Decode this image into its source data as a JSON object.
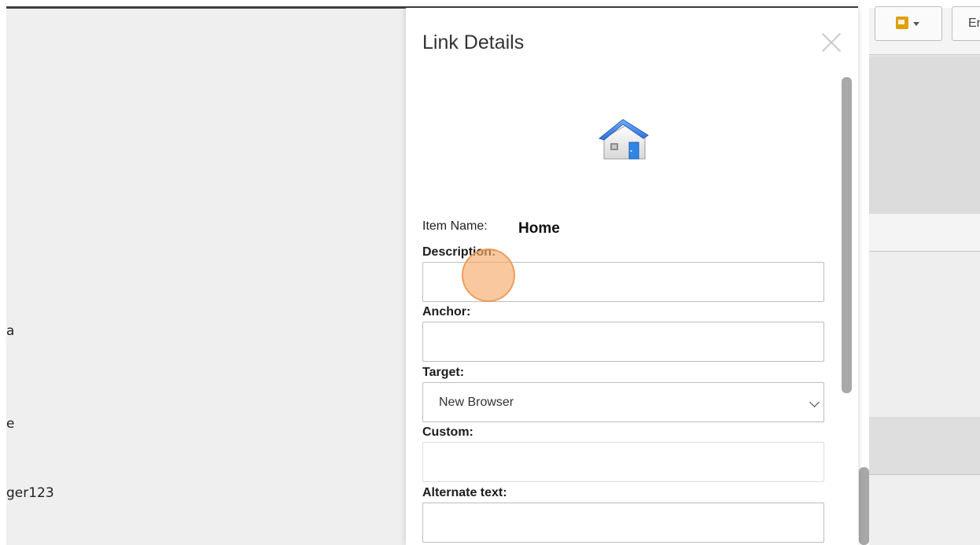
{
  "background": {
    "left_fragments": [
      "a",
      "e",
      "ger123"
    ],
    "toolbar": {
      "right_button_label": "Er"
    }
  },
  "dialog": {
    "title": "Link Details",
    "item_name_label": "Item Name:",
    "item_name_value": "Home",
    "item_icon": "home-icon",
    "fields": {
      "description": {
        "label": "Description:",
        "value": ""
      },
      "anchor": {
        "label": "Anchor:",
        "value": ""
      },
      "target": {
        "label": "Target:",
        "value": "New Browser"
      },
      "custom": {
        "label": "Custom:",
        "value": ""
      },
      "alternate_text": {
        "label": "Alternate text:",
        "value": ""
      }
    }
  },
  "colors": {
    "click_indicator": "#f6aa6c",
    "scrollbar": "#a9a9a9",
    "home_roof": "#3b82f6"
  }
}
